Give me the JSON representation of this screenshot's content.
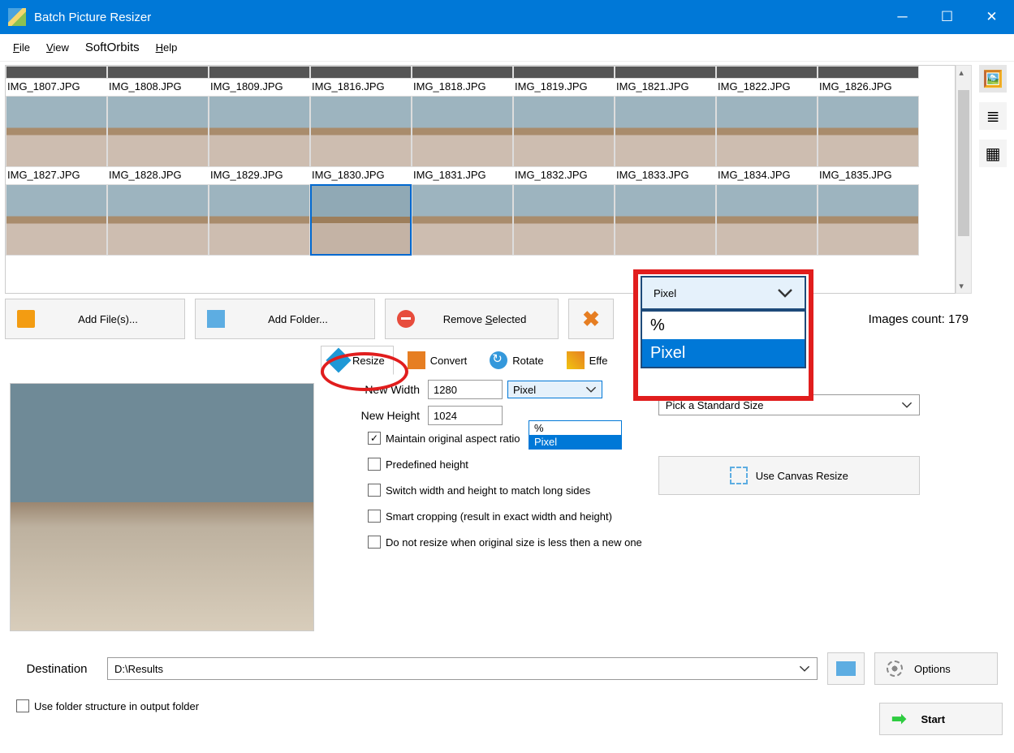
{
  "titlebar": {
    "title": "Batch Picture Resizer"
  },
  "menu": {
    "file": "File",
    "view": "View",
    "softorbits": "SoftOrbits",
    "help": "Help"
  },
  "thumbs_partial": [
    "IMG_1807.JPG",
    "IMG_1808.JPG",
    "IMG_1809.JPG",
    "IMG_1816.JPG",
    "IMG_1818.JPG",
    "IMG_1819.JPG",
    "IMG_1821.JPG",
    "IMG_1822.JPG",
    "IMG_1826.JPG"
  ],
  "thumbs_row2": [
    "IMG_1827.JPG",
    "IMG_1828.JPG",
    "IMG_1829.JPG",
    "IMG_1830.JPG",
    "IMG_1831.JPG",
    "IMG_1832.JPG",
    "IMG_1833.JPG",
    "IMG_1834.JPG",
    "IMG_1835.JPG"
  ],
  "buttons": {
    "add_files": "Add File(s)...",
    "add_folder": "Add Folder...",
    "remove_selected": "Remove Selected",
    "images_count": "Images count: 179"
  },
  "tabs": {
    "resize": "Resize",
    "convert": "Convert",
    "rotate": "Rotate",
    "effects": "Effects"
  },
  "resize": {
    "new_width_label": "New Width",
    "new_width_value": "1280",
    "new_height_label": "New Height",
    "new_height_value": "1024",
    "unit_selected": "Pixel",
    "unit_options": [
      "%",
      "Pixel"
    ],
    "maintain_ratio": "Maintain original aspect ratio",
    "predefined_height": "Predefined height",
    "switch_wh": "Switch width and height to match long sides",
    "smart_cropping": "Smart cropping (result in exact width and height)",
    "no_resize_smaller": "Do not resize when original size is less then a new one",
    "standard_size": "Pick a Standard Size",
    "canvas_resize": "Use Canvas Resize"
  },
  "highlight": {
    "selected": "Pixel",
    "options": [
      "%",
      "Pixel"
    ]
  },
  "destination": {
    "label": "Destination",
    "value": "D:\\Results",
    "options": "Options",
    "start": "Start",
    "use_folder_structure": "Use folder structure in output folder"
  }
}
